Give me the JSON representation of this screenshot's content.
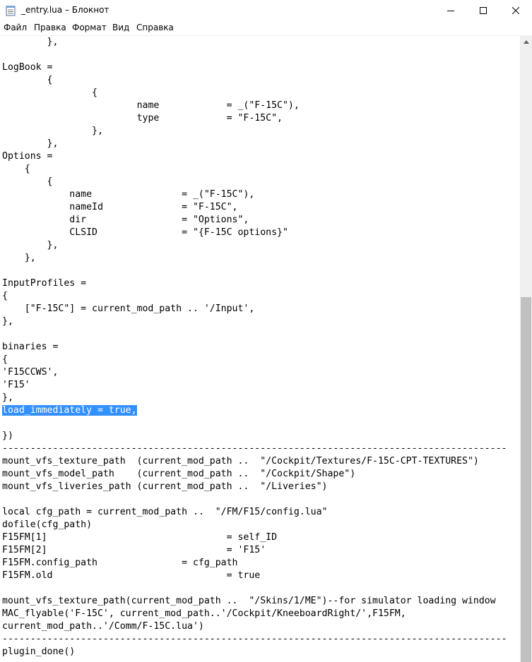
{
  "window": {
    "title": "_entry.lua – Блокнот",
    "icon": "notepad-icon",
    "controls": {
      "minimize_icon": "minimize-icon",
      "maximize_icon": "maximize-icon",
      "close_icon": "close-icon"
    }
  },
  "menu": {
    "items": [
      {
        "label": "Файл"
      },
      {
        "label": "Правка"
      },
      {
        "label": "Формат"
      },
      {
        "label": "Вид"
      },
      {
        "label": "Справка"
      }
    ]
  },
  "editor": {
    "lines_before_selection": [
      "\t},",
      "",
      "LogBook =",
      "\t{",
      "\t\t{",
      "\t\t\tname\t\t= _(\"F-15C\"),",
      "\t\t\ttype\t\t= \"F-15C\",",
      "\t\t},",
      "\t},",
      "Options =",
      "    {",
      "\t{",
      "\t    name\t\t= _(\"F-15C\"),",
      "\t    nameId\t\t= \"F-15C\",",
      "\t    dir\t\t\t= \"Options\",",
      "\t    CLSID\t\t= \"{F-15C options}\"",
      "\t},",
      "    },",
      "",
      "InputProfiles =",
      "{",
      "    [\"F-15C\"] = current_mod_path .. '/Input',",
      "},",
      "",
      "binaries =",
      "{",
      "'F15CCWS',",
      "'F15'",
      "},"
    ],
    "selected_text": "load_immediately = true,",
    "lines_after_selection": [
      "",
      "})",
      "------------------------------------------------------------------------------------------",
      "mount_vfs_texture_path  (current_mod_path ..  \"/Cockpit/Textures/F-15C-CPT-TEXTURES\")",
      "mount_vfs_model_path    (current_mod_path ..  \"/Cockpit/Shape\")",
      "mount_vfs_liveries_path (current_mod_path ..  \"/Liveries\")",
      "",
      "local cfg_path = current_mod_path ..  \"/FM/F15/config.lua\"",
      "dofile(cfg_path)",
      "F15FM[1]\t\t\t\t= self_ID",
      "F15FM[2]\t\t\t\t= 'F15'",
      "F15FM.config_path\t\t= cfg_path",
      "F15FM.old\t\t\t\t= true",
      "",
      "mount_vfs_texture_path(current_mod_path ..  \"/Skins/1/ME\")--for simulator loading window",
      "MAC_flyable('F-15C', current_mod_path..'/Cockpit/KneeboardRight/',F15FM,",
      "current_mod_path..'/Comm/F-15C.lua')",
      "------------------------------------------------------------------------------------------",
      "plugin_done()"
    ]
  },
  "scrollbar": {
    "up_icon": "scroll-up-arrow-icon",
    "position_fraction": 0.42
  }
}
